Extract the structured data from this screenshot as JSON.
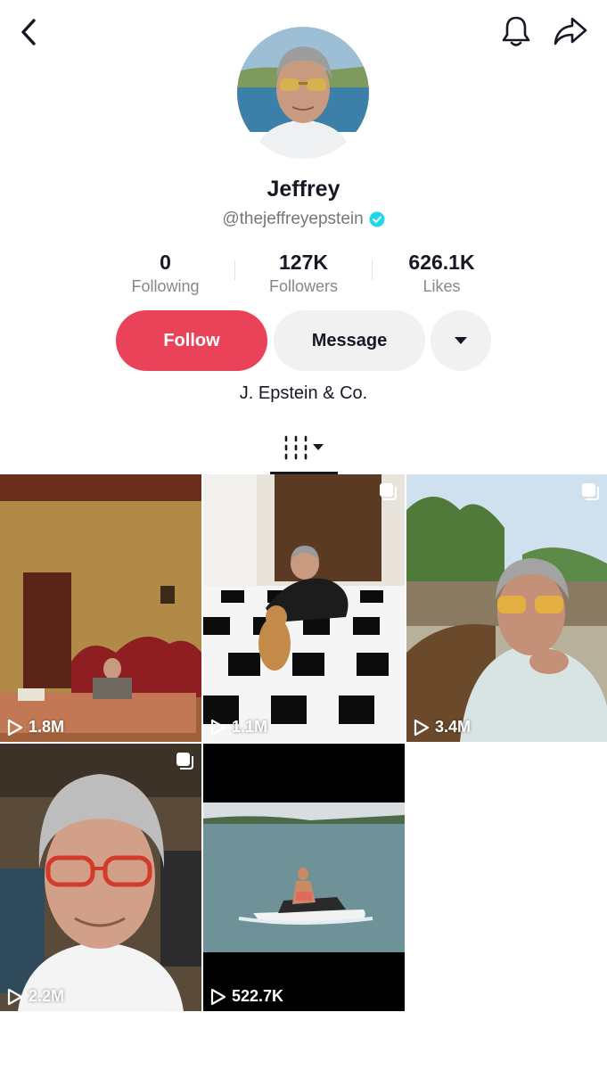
{
  "profile": {
    "name": "Jeffrey",
    "handle": "@thejeffreyepstein",
    "verified": true,
    "bio": "J. Epstein & Co."
  },
  "stats": [
    {
      "value": "0",
      "label": "Following"
    },
    {
      "value": "127K",
      "label": "Followers"
    },
    {
      "value": "626.1K",
      "label": "Likes"
    }
  ],
  "actions": {
    "follow_label": "Follow",
    "message_label": "Message"
  },
  "icons": {
    "back": "chevron-left-icon",
    "notifications": "bell-icon",
    "share": "share-arrow-icon",
    "more": "caret-down-icon",
    "verified": "verified-badge-icon",
    "videos_tab": "grid-lines-icon",
    "views": "play-icon",
    "multi": "carousel-icon"
  },
  "videos": [
    {
      "views": "1.8M",
      "scene": "man seated in ornate room"
    },
    {
      "views": "1.1M",
      "scene": "man lying on checkered floor with dog"
    },
    {
      "views": "3.4M",
      "scene": "man in sunglasses outdoors"
    },
    {
      "views": "2.2M",
      "scene": "man with red glasses selfie"
    },
    {
      "views": "522.7K",
      "scene": "man on jet ski"
    }
  ],
  "colors": {
    "follow": "#ea4359",
    "secondary_button": "#f1f1f2",
    "verified": "#20d5ec",
    "muted_text": "#86878b"
  }
}
